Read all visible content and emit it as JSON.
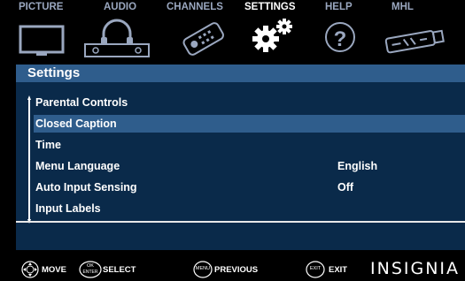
{
  "tabs": [
    {
      "label": "PICTURE",
      "icon": "tv-icon"
    },
    {
      "label": "AUDIO",
      "icon": "headphones-icon"
    },
    {
      "label": "CHANNELS",
      "icon": "remote-control-icon"
    },
    {
      "label": "SETTINGS",
      "icon": "gears-icon"
    },
    {
      "label": "HELP",
      "icon": "question-mark-icon"
    },
    {
      "label": "MHL",
      "icon": "mhl-cable-icon"
    }
  ],
  "active_tab": "SETTINGS",
  "menu": {
    "title": "Settings",
    "items": [
      {
        "label": "Parental Controls",
        "value": ""
      },
      {
        "label": "Closed Caption",
        "value": ""
      },
      {
        "label": "Time",
        "value": ""
      },
      {
        "label": "Menu Language",
        "value": "English"
      },
      {
        "label": "Auto Input Sensing",
        "value": "Off"
      },
      {
        "label": "Input Labels",
        "value": ""
      }
    ],
    "selected_item": "Closed Caption"
  },
  "footer": {
    "move_label": "MOVE",
    "ok_key_line1": "OK",
    "ok_key_line2": "ENTER",
    "select_label": "SELECT",
    "menu_key": "MENU",
    "previous_label": "PREVIOUS",
    "exit_key": "EXIT",
    "exit_label": "EXIT",
    "brand": "INSIGNIA"
  },
  "colors": {
    "tab_inactive": "#9aa7bf",
    "highlight": "#2f5d8c",
    "panel": "#0a2a4a"
  }
}
